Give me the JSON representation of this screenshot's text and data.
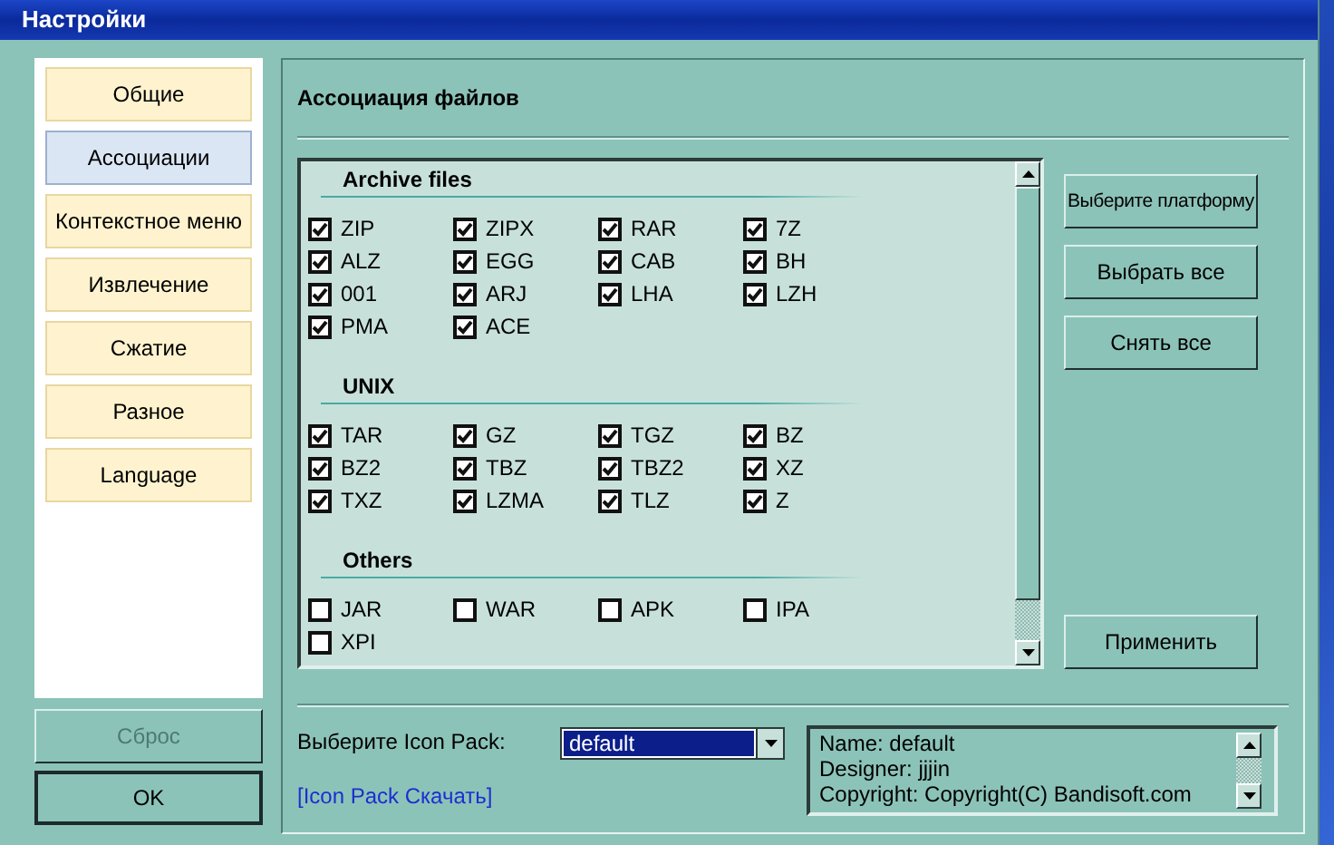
{
  "window": {
    "title": "Настройки"
  },
  "sidebar": {
    "items": [
      {
        "label": "Общие",
        "selected": false
      },
      {
        "label": "Ассоциации",
        "selected": true
      },
      {
        "label": "Контекстное меню",
        "selected": false
      },
      {
        "label": "Извлечение",
        "selected": false
      },
      {
        "label": "Сжатие",
        "selected": false
      },
      {
        "label": "Разное",
        "selected": false
      },
      {
        "label": "Language",
        "selected": false
      }
    ]
  },
  "footer_buttons": [
    {
      "label": "Сброс",
      "disabled": true
    },
    {
      "label": "OK",
      "disabled": false
    }
  ],
  "panel": {
    "title": "Ассоциация файлов",
    "groups": [
      {
        "title": "Archive files",
        "items": [
          {
            "label": "ZIP",
            "checked": true
          },
          {
            "label": "ZIPX",
            "checked": true
          },
          {
            "label": "RAR",
            "checked": true
          },
          {
            "label": "7Z",
            "checked": true
          },
          {
            "label": "ALZ",
            "checked": true
          },
          {
            "label": "EGG",
            "checked": true
          },
          {
            "label": "CAB",
            "checked": true
          },
          {
            "label": "BH",
            "checked": true
          },
          {
            "label": "001",
            "checked": true
          },
          {
            "label": "ARJ",
            "checked": true
          },
          {
            "label": "LHA",
            "checked": true
          },
          {
            "label": "LZH",
            "checked": true
          },
          {
            "label": "PMA",
            "checked": true
          },
          {
            "label": "ACE",
            "checked": true
          }
        ]
      },
      {
        "title": "UNIX",
        "items": [
          {
            "label": "TAR",
            "checked": true
          },
          {
            "label": "GZ",
            "checked": true
          },
          {
            "label": "TGZ",
            "checked": true
          },
          {
            "label": "BZ",
            "checked": true
          },
          {
            "label": "BZ2",
            "checked": true
          },
          {
            "label": "TBZ",
            "checked": true
          },
          {
            "label": "TBZ2",
            "checked": true
          },
          {
            "label": "XZ",
            "checked": true
          },
          {
            "label": "TXZ",
            "checked": true
          },
          {
            "label": "LZMA",
            "checked": true
          },
          {
            "label": "TLZ",
            "checked": true
          },
          {
            "label": "Z",
            "checked": true
          }
        ]
      },
      {
        "title": "Others",
        "items": [
          {
            "label": "JAR",
            "checked": false
          },
          {
            "label": "WAR",
            "checked": false
          },
          {
            "label": "APK",
            "checked": false
          },
          {
            "label": "IPA",
            "checked": false
          },
          {
            "label": "XPI",
            "checked": false
          }
        ]
      }
    ],
    "side_buttons": [
      "Выберите платформу",
      "Выбрать все",
      "Снять все"
    ],
    "apply_button": "Применить",
    "icon_pack": {
      "label": "Выберите Icon Pack:",
      "value": "default",
      "link": "[Icon Pack Скачать]",
      "info": [
        "Name: default",
        "Designer: jjjin",
        "Copyright: Copyright(C) Bandisoft.com"
      ]
    }
  }
}
